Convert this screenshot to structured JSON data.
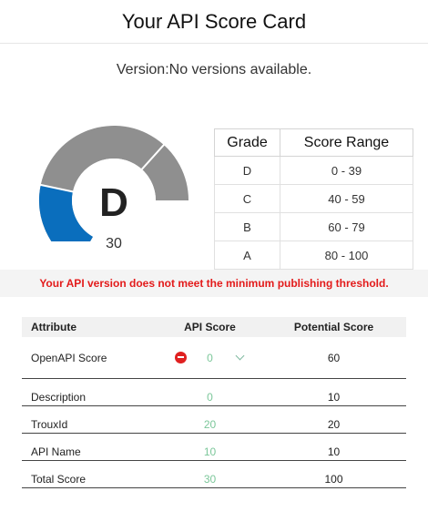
{
  "header": {
    "title": "Your API Score Card"
  },
  "version": {
    "label": "Version:",
    "value": "No versions available."
  },
  "gauge": {
    "grade": "D",
    "score": "30",
    "max": 100,
    "fraction": 0.3,
    "fill_color": "#0a6ebd",
    "track_color": "#8f8f8f"
  },
  "grade_table": {
    "headers": [
      "Grade",
      "Score Range"
    ],
    "rows": [
      {
        "grade": "D",
        "range": "0 - 39"
      },
      {
        "grade": "C",
        "range": "40 - 59"
      },
      {
        "grade": "B",
        "range": "60 - 79"
      },
      {
        "grade": "A",
        "range": "80 - 100"
      }
    ]
  },
  "warning": {
    "text": "Your API version does not meet the minimum publishing threshold.",
    "color": "#e31b1b"
  },
  "attributes": {
    "headers": [
      "Attribute",
      "API Score",
      "Potential Score"
    ],
    "rows": [
      {
        "name": "OpenAPI Score",
        "score": "0",
        "potential": "60",
        "status_icon": "minus-circle-icon",
        "expand_icon": "chevron-down-icon"
      },
      {
        "name": "Description",
        "score": "0",
        "potential": "10"
      },
      {
        "name": "TrouxId",
        "score": "20",
        "potential": "20"
      },
      {
        "name": "API Name",
        "score": "10",
        "potential": "10"
      },
      {
        "name": "Total Score",
        "score": "30",
        "potential": "100"
      }
    ]
  }
}
